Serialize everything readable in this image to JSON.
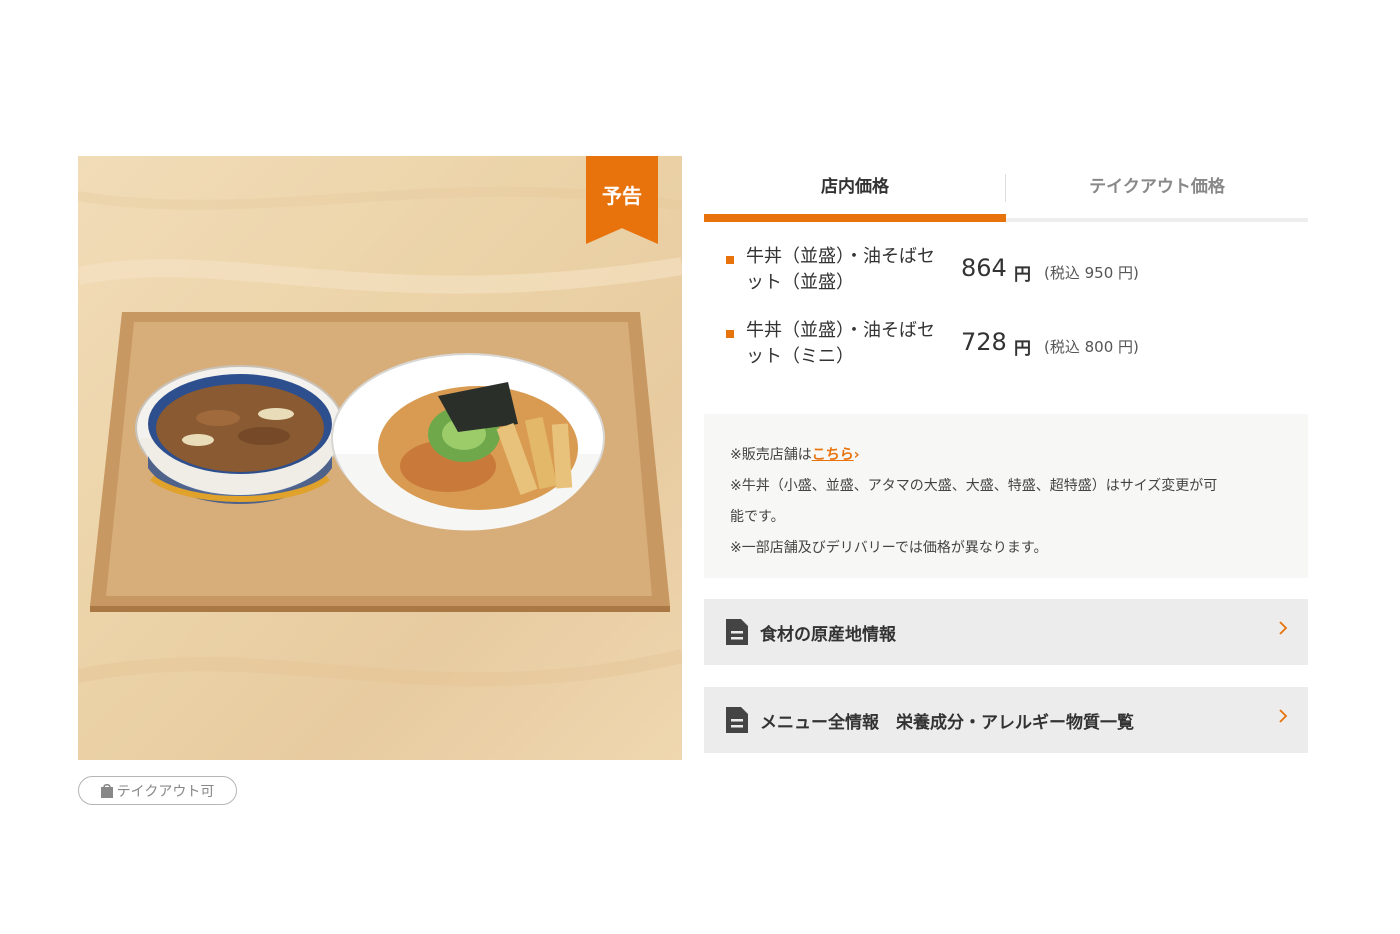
{
  "image": {
    "alt": "牛丼（並盛）・油そばセット",
    "badge": "予告"
  },
  "takeout_pill": {
    "label": "テイクアウト可",
    "icon": "shopping-bag-icon"
  },
  "tabs": [
    {
      "label": "店内価格",
      "active": true
    },
    {
      "label": "テイクアウト価格",
      "active": false
    }
  ],
  "prices": [
    {
      "name_line1": "牛丼（並盛）・油そばセ",
      "name_line2": "ット（並盛）",
      "price": "864",
      "yen": "円",
      "taxed": "(税込 950 円)"
    },
    {
      "name_line1": "牛丼（並盛）・油そばセ",
      "name_line2": "ット（ミニ）",
      "price": "728",
      "yen": "円",
      "taxed": "(税込 800 円)"
    }
  ],
  "notes": {
    "line1_prefix": "※販売店舗は",
    "line1_link": "こちら",
    "line2": "※牛丼（小盛、並盛、アタマの大盛、大盛、特盛、超特盛）はサイズ変更が可",
    "line2b": "能です。",
    "line3": "※一部店舗及びデリバリーでは価格が異なります。"
  },
  "links": [
    {
      "label": "食材の原産地情報",
      "icon": "document-icon"
    },
    {
      "label": "メニュー全情報　栄養成分・アレルギー物質一覧",
      "icon": "document-icon"
    }
  ],
  "colors": {
    "accent": "#e8720c",
    "panel": "#ececec",
    "note_bg": "#f7f7f5"
  }
}
